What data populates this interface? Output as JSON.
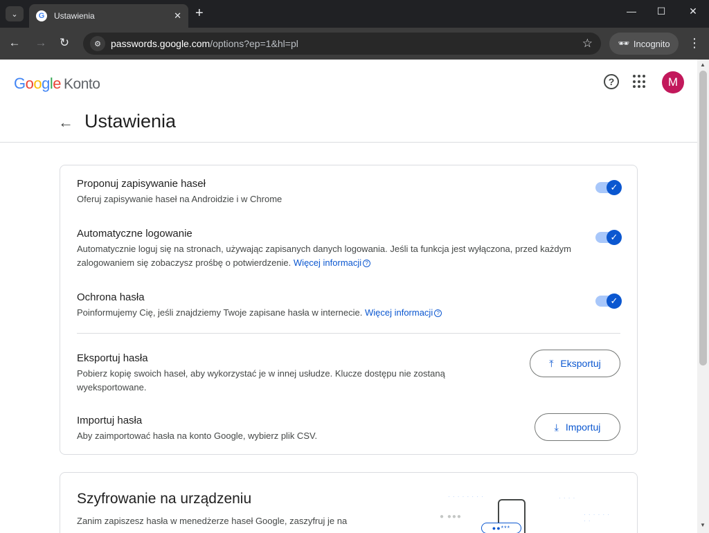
{
  "browser": {
    "tab_title": "Ustawienia",
    "url_host": "passwords.google.com",
    "url_rest": "/options?ep=1&hl=pl",
    "incognito_label": "Incognito"
  },
  "header": {
    "logo_google": "Google",
    "logo_product": "Konto",
    "avatar_letter": "M"
  },
  "page": {
    "title": "Ustawienia"
  },
  "settings": {
    "offer_save": {
      "title": "Proponuj zapisywanie haseł",
      "desc": "Oferuj zapisywanie haseł na Androidzie i w Chrome",
      "enabled": true
    },
    "auto_signin": {
      "title": "Automatyczne logowanie",
      "desc": "Automatycznie loguj się na stronach, używając zapisanych danych logowania. Jeśli ta funkcja jest wyłączona, przed każdym zalogowaniem się zobaczysz prośbę o potwierdzenie.",
      "link": "Więcej informacji",
      "enabled": true
    },
    "password_protection": {
      "title": "Ochrona hasła",
      "desc": "Poinformujemy Cię, jeśli znajdziemy Twoje zapisane hasła w internecie.",
      "link": "Więcej informacji",
      "enabled": true
    },
    "export": {
      "title": "Eksportuj hasła",
      "desc": "Pobierz kopię swoich haseł, aby wykorzystać je w innej usłudze. Klucze dostępu nie zostaną wyeksportowane.",
      "button": "Eksportuj"
    },
    "import": {
      "title": "Importuj hasła",
      "desc": "Aby zaimportować hasła na konto Google, wybierz plik CSV.",
      "button": "Importuj"
    }
  },
  "encryption": {
    "title": "Szyfrowanie na urządzeniu",
    "desc": "Zanim zapiszesz hasła w menedżerze haseł Google, zaszyfruj je na",
    "illustration_text": "●●***"
  },
  "colors": {
    "accent": "#0b57d0",
    "toggle_track": "#a8c7fa",
    "avatar": "#c2185b"
  }
}
